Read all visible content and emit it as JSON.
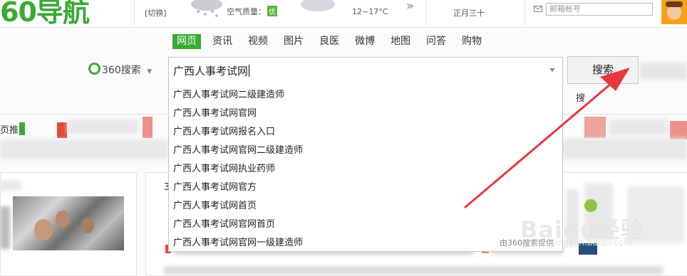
{
  "header": {
    "logo_text": "60导航",
    "switch_label": "[切换]",
    "aqi_label": "空气质量：",
    "aqi_value": "优",
    "temperature": "12~17°C",
    "more_glyph": "»",
    "lunar_date": "正月三十",
    "mail_placeholder": "邮箱帐号"
  },
  "nav_tabs": [
    "网页",
    "资讯",
    "视频",
    "图片",
    "良医",
    "微博",
    "地图",
    "问答",
    "购物"
  ],
  "search": {
    "brand": "360搜索",
    "query": "广西人事考试网",
    "button_label": "搜索",
    "button_subtext": "搜"
  },
  "suggestions": [
    "广西人事考试网二级建造师",
    "广西人事考试网官网",
    "广西人事考试网报名入口",
    "广西人事考试网官网二级建造师",
    "广西人事考试网执业药师",
    "广西人事考试网官方",
    "广西人事考试网首页",
    "广西人事考试网官网首页",
    "广西人事考试网官网一级建造师"
  ],
  "suggest_footer": "由360搜索提供",
  "left_tab_fragment": "页推",
  "mid_fragment": "3",
  "watermark": {
    "brand": "Baidu经验",
    "url": "jingyan.baidu.com"
  },
  "colors": {
    "brand_green": "#3aa935",
    "arrow_red": "#e8383d"
  }
}
